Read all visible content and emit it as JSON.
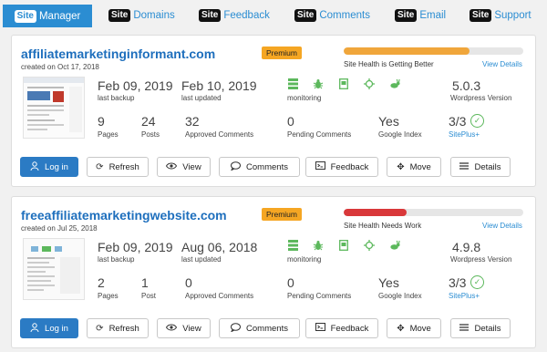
{
  "nav": [
    {
      "badge": "Site",
      "label": "Manager"
    },
    {
      "badge": "Site",
      "label": "Domains"
    },
    {
      "badge": "Site",
      "label": "Feedback"
    },
    {
      "badge": "Site",
      "label": "Comments"
    },
    {
      "badge": "Site",
      "label": "Email"
    },
    {
      "badge": "Site",
      "label": "Support"
    }
  ],
  "sites": [
    {
      "domain": "affiliatemarketinginformant.com",
      "created": "created on Oct 17, 2018",
      "badge": "Premium",
      "health_label": "Site Health is Getting Better",
      "health_level": 0.7,
      "health_color": "#f0a63b",
      "view_details": "View Details",
      "last_backup": "Feb 09, 2019",
      "last_backup_label": "last backup",
      "last_updated": "Feb 10, 2019",
      "last_updated_label": "last updated",
      "monitoring_label": "monitoring",
      "wp_version": "5.0.3",
      "wp_version_label": "Wordpress Version",
      "pages": "9",
      "pages_label": "Pages",
      "posts": "24",
      "posts_label": "Posts",
      "approved_comments": "32",
      "approved_comments_label": "Approved Comments",
      "pending_comments": "0",
      "pending_comments_label": "Pending Comments",
      "google_index": "Yes",
      "google_index_label": "Google Index",
      "siteplus": "3/3",
      "siteplus_label": "SitePlus+"
    },
    {
      "domain": "freeaffiliatemarketingwebsite.com",
      "created": "created on Jul 25, 2018",
      "badge": "Premium",
      "health_label": "Site Health Needs Work",
      "health_level": 0.35,
      "health_color": "#d9383a",
      "view_details": "View Details",
      "last_backup": "Feb 09, 2019",
      "last_backup_label": "last backup",
      "last_updated": "Aug 06, 2018",
      "last_updated_label": "last updated",
      "monitoring_label": "monitoring",
      "wp_version": "4.9.8",
      "wp_version_label": "Wordpress Version",
      "pages": "2",
      "pages_label": "Pages",
      "posts": "1",
      "posts_label": "Post",
      "approved_comments": "0",
      "approved_comments_label": "Approved Comments",
      "pending_comments": "0",
      "pending_comments_label": "Pending Comments",
      "google_index": "Yes",
      "google_index_label": "Google Index",
      "siteplus": "3/3",
      "siteplus_label": "SitePlus+"
    }
  ],
  "buttons": {
    "login": "Log in",
    "refresh": "Refresh",
    "view": "View",
    "comments": "Comments",
    "feedback": "Feedback",
    "move": "Move",
    "details": "Details"
  },
  "icons": {
    "login": "user-icon",
    "refresh": "refresh-icon",
    "view": "eye-icon",
    "comments": "speech-bubble-icon",
    "feedback": "terminal-icon",
    "move": "move-arrows-icon",
    "details": "menu-lines-icon",
    "monitoring": [
      "server-icon",
      "bug-icon",
      "document-icon",
      "crosshair-icon",
      "rabbit-icon"
    ]
  },
  "colors": {
    "accent": "#2b8dd2",
    "primary_button": "#2b7bc4",
    "premium": "#f5a623",
    "monitor_green": "#5cb85c"
  }
}
